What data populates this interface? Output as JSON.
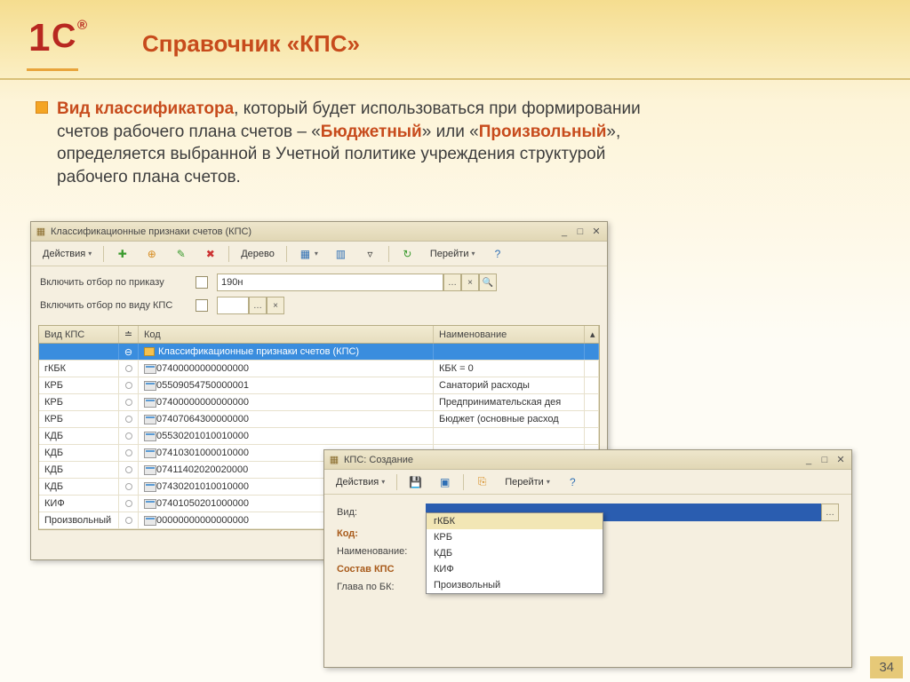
{
  "slide": {
    "title": "Справочник «КПС»",
    "page_number": "34",
    "intro_parts": {
      "p1": "Вид классификатора",
      "p2": ", который будет использоваться при формировании счетов рабочего плана счетов – «",
      "p3": "Бюджетный",
      "p4": "» или «",
      "p5": "Произвольный",
      "p6": "», определяется выбранной в Учетной политике учреждения структурой рабочего плана счетов."
    }
  },
  "win1": {
    "title": "Классификационные признаки счетов (КПС)",
    "toolbar": {
      "actions": "Действия",
      "tree": "Дерево",
      "go": "Перейти"
    },
    "filters": {
      "f1_label": "Включить отбор по приказу",
      "f1_value": "190н",
      "f2_label": "Включить отбор по виду КПС"
    },
    "grid": {
      "headers": {
        "type": "Вид КПС",
        "code": "Код",
        "name": "Наименование"
      },
      "group_label": "Классификационные признаки счетов (КПС)",
      "rows": [
        {
          "type": "гКБК",
          "code": "07400000000000000",
          "name": "КБК = 0"
        },
        {
          "type": "КРБ",
          "code": "05509054750000001",
          "name": "Санаторий расходы"
        },
        {
          "type": "КРБ",
          "code": "07400000000000000",
          "name": "Предпринимательская дея"
        },
        {
          "type": "КРБ",
          "code": "07407064300000000",
          "name": "Бюджет (основные расход"
        },
        {
          "type": "КДБ",
          "code": "05530201010010000",
          "name": ""
        },
        {
          "type": "КДБ",
          "code": "07410301000010000",
          "name": ""
        },
        {
          "type": "КДБ",
          "code": "07411402020020000",
          "name": ""
        },
        {
          "type": "КДБ",
          "code": "07430201010010000",
          "name": ""
        },
        {
          "type": "КИФ",
          "code": "07401050201000000",
          "name": ""
        },
        {
          "type": "Произвольный",
          "code": "00000000000000000",
          "name": ""
        }
      ]
    }
  },
  "win2": {
    "title": "КПС: Создание",
    "toolbar": {
      "actions": "Действия",
      "go": "Перейти"
    },
    "form": {
      "vid": "Вид:",
      "kod": "Код:",
      "naim": "Наименование:",
      "sostav": "Состав КПС",
      "glava": "Глава по БК:"
    },
    "dropdown": [
      "гКБК",
      "КРБ",
      "КДБ",
      "КИФ",
      "Произвольный"
    ]
  }
}
